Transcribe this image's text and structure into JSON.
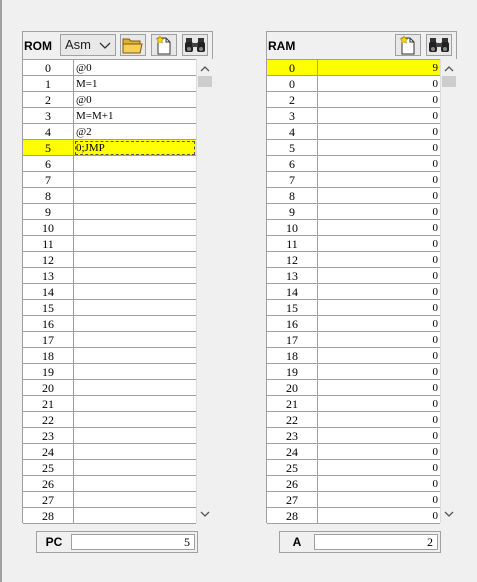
{
  "rom": {
    "title": "ROM",
    "format": "Asm",
    "highlight_row": 5,
    "rows": [
      {
        "addr": "0",
        "value": "@0"
      },
      {
        "addr": "1",
        "value": "M=1"
      },
      {
        "addr": "2",
        "value": "@0"
      },
      {
        "addr": "3",
        "value": "M=M+1"
      },
      {
        "addr": "4",
        "value": "@2"
      },
      {
        "addr": "5",
        "value": "0;JMP"
      },
      {
        "addr": "6",
        "value": ""
      },
      {
        "addr": "7",
        "value": ""
      },
      {
        "addr": "8",
        "value": ""
      },
      {
        "addr": "9",
        "value": ""
      },
      {
        "addr": "10",
        "value": ""
      },
      {
        "addr": "11",
        "value": ""
      },
      {
        "addr": "12",
        "value": ""
      },
      {
        "addr": "13",
        "value": ""
      },
      {
        "addr": "14",
        "value": ""
      },
      {
        "addr": "15",
        "value": ""
      },
      {
        "addr": "16",
        "value": ""
      },
      {
        "addr": "17",
        "value": ""
      },
      {
        "addr": "18",
        "value": ""
      },
      {
        "addr": "19",
        "value": ""
      },
      {
        "addr": "20",
        "value": ""
      },
      {
        "addr": "21",
        "value": ""
      },
      {
        "addr": "22",
        "value": ""
      },
      {
        "addr": "23",
        "value": ""
      },
      {
        "addr": "24",
        "value": ""
      },
      {
        "addr": "25",
        "value": ""
      },
      {
        "addr": "26",
        "value": ""
      },
      {
        "addr": "27",
        "value": ""
      },
      {
        "addr": "28",
        "value": ""
      }
    ]
  },
  "ram": {
    "title": "RAM",
    "highlight_row": 0,
    "rows": [
      {
        "addr": "0",
        "value": "9"
      },
      {
        "addr": "0",
        "value": "0"
      },
      {
        "addr": "2",
        "value": "0"
      },
      {
        "addr": "3",
        "value": "0"
      },
      {
        "addr": "4",
        "value": "0"
      },
      {
        "addr": "5",
        "value": "0"
      },
      {
        "addr": "6",
        "value": "0"
      },
      {
        "addr": "7",
        "value": "0"
      },
      {
        "addr": "8",
        "value": "0"
      },
      {
        "addr": "9",
        "value": "0"
      },
      {
        "addr": "10",
        "value": "0"
      },
      {
        "addr": "11",
        "value": "0"
      },
      {
        "addr": "12",
        "value": "0"
      },
      {
        "addr": "13",
        "value": "0"
      },
      {
        "addr": "14",
        "value": "0"
      },
      {
        "addr": "15",
        "value": "0"
      },
      {
        "addr": "16",
        "value": "0"
      },
      {
        "addr": "17",
        "value": "0"
      },
      {
        "addr": "18",
        "value": "0"
      },
      {
        "addr": "19",
        "value": "0"
      },
      {
        "addr": "20",
        "value": "0"
      },
      {
        "addr": "21",
        "value": "0"
      },
      {
        "addr": "22",
        "value": "0"
      },
      {
        "addr": "23",
        "value": "0"
      },
      {
        "addr": "24",
        "value": "0"
      },
      {
        "addr": "25",
        "value": "0"
      },
      {
        "addr": "26",
        "value": "0"
      },
      {
        "addr": "27",
        "value": "0"
      },
      {
        "addr": "28",
        "value": "0"
      }
    ]
  },
  "registers": {
    "pc": {
      "label": "PC",
      "value": "5"
    },
    "a": {
      "label": "A",
      "value": "2"
    }
  },
  "colors": {
    "highlight": "#ffff00",
    "border": "#a0a0a0",
    "background": "#f0f0f0"
  },
  "icons": {
    "open": "folder-open-icon",
    "new": "new-document-icon",
    "find": "binoculars-icon",
    "dropdown": "chevron-down-icon"
  }
}
